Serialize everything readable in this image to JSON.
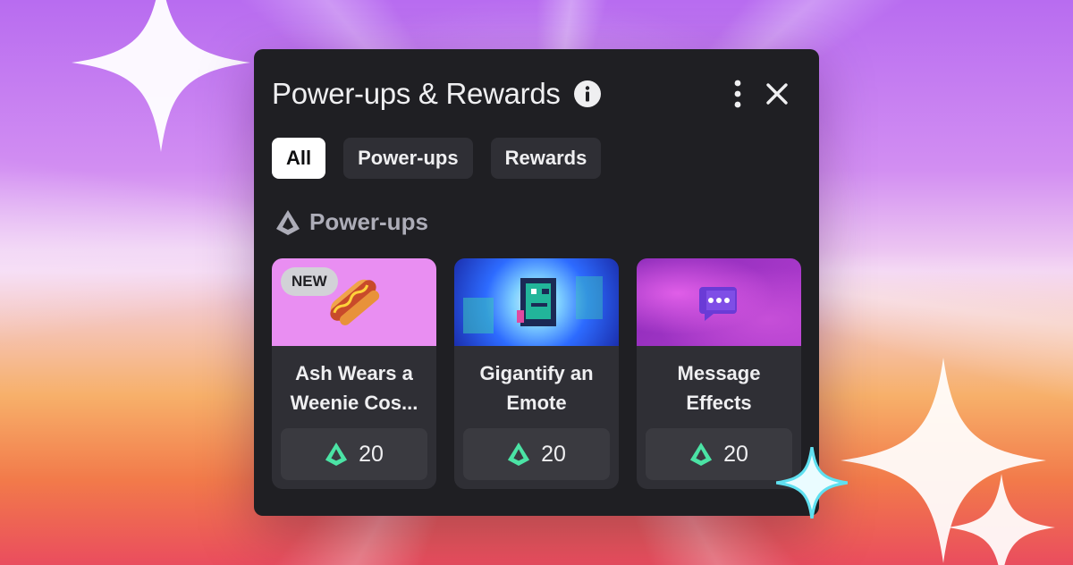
{
  "panel": {
    "title": "Power-ups & Rewards"
  },
  "tabs": [
    {
      "label": "All",
      "active": true
    },
    {
      "label": "Power-ups",
      "active": false
    },
    {
      "label": "Rewards",
      "active": false
    }
  ],
  "section": {
    "title": "Power-ups"
  },
  "cards": [
    {
      "title": "Ash Wears a Weenie Cos...",
      "price": "20",
      "badge": "NEW",
      "icon": "hotdog-icon"
    },
    {
      "title": "Gigantify an Emote",
      "price": "20",
      "icon": "pixel-dinosaur-icon"
    },
    {
      "title": "Message Effects",
      "price": "20",
      "icon": "chat-bubble-icon"
    }
  ],
  "icons": {
    "info": "info-icon",
    "more": "more-vertical-icon",
    "close": "close-icon",
    "section": "bits-gem-icon",
    "price": "bits-gem-icon"
  },
  "colors": {
    "panel_bg": "#1f1f23",
    "card_bg": "#2f2f35",
    "gem_accent": "#4be3a5"
  }
}
